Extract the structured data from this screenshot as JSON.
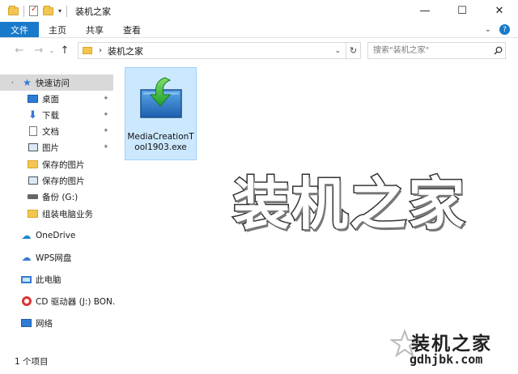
{
  "window": {
    "title": "装机之家",
    "controls": {
      "minimize": "—",
      "maximize": "☐",
      "close": "✕"
    }
  },
  "ribbon": {
    "file_tab": "文件",
    "tabs": [
      "主页",
      "共享",
      "查看"
    ],
    "expand_glyph": "⌄",
    "help_glyph": "?"
  },
  "navbar": {
    "back_glyph": "←",
    "forward_glyph": "→",
    "recent_glyph": "⌄",
    "up_glyph": "↑",
    "address": {
      "chevron": "›",
      "path": "装机之家",
      "dropdown_glyph": "⌄"
    },
    "refresh_glyph": "↻",
    "search": {
      "placeholder": "搜索\"装机之家\""
    }
  },
  "sidebar": {
    "items": [
      {
        "label": "快速访问",
        "icon": "star-icon",
        "selected": true,
        "expand": "›"
      },
      {
        "label": "桌面",
        "icon": "desktop-icon",
        "pinned": true
      },
      {
        "label": "下载",
        "icon": "download-icon",
        "pinned": true
      },
      {
        "label": "文档",
        "icon": "document-icon",
        "pinned": true
      },
      {
        "label": "图片",
        "icon": "picture-icon",
        "pinned": true
      },
      {
        "label": "保存的图片",
        "icon": "folder-icon"
      },
      {
        "label": "保存的图片",
        "icon": "picture-icon"
      },
      {
        "label": "备份 (G:)",
        "icon": "drive-icon"
      },
      {
        "label": "组装电脑业务",
        "icon": "folder-icon"
      },
      {
        "label": "OneDrive",
        "icon": "cloud-icon"
      },
      {
        "label": "WPS网盘",
        "icon": "cloud-icon"
      },
      {
        "label": "此电脑",
        "icon": "computer-icon"
      },
      {
        "label": "CD 驱动器 (J:) BON.",
        "icon": "cd-icon"
      },
      {
        "label": "网络",
        "icon": "network-icon"
      }
    ],
    "pin_glyph": "📌"
  },
  "content": {
    "files": [
      {
        "name": "MediaCreationTool1903.exe",
        "icon": "installer-icon",
        "selected": true
      }
    ]
  },
  "watermark": {
    "center_text": "装机之家",
    "corner_text": "装机之家",
    "corner_url": "gdhjbk.com"
  },
  "status_bar": {
    "item_count": "1 个项目"
  },
  "colors": {
    "accent": "#1979ca",
    "selection_bg": "#cce8ff",
    "folder": "#f3c74f"
  }
}
